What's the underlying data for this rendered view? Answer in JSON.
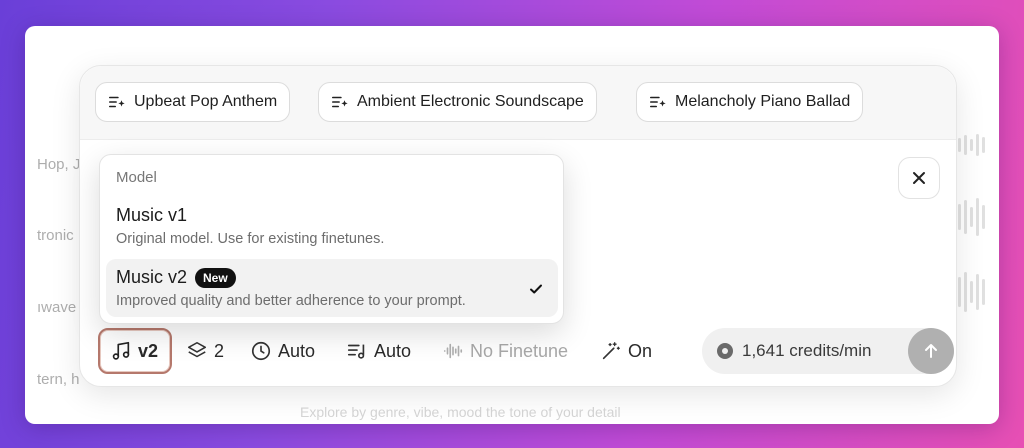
{
  "suggestions": [
    {
      "label": "Upbeat Pop Anthem",
      "icon": "sparkle-list-icon"
    },
    {
      "label": "Ambient Electronic Soundscape",
      "icon": "sparkle-list-icon"
    },
    {
      "label": "Melancholy Piano Ballad",
      "icon": "sparkle-list-icon"
    }
  ],
  "background_snippets": [
    "Hop, J",
    "tronic",
    "ıwave",
    "tern, h"
  ],
  "model_menu": {
    "header": "Model",
    "options": [
      {
        "title": "Music v1",
        "description": "Original model. Use for existing finetunes.",
        "badge": "",
        "selected": false
      },
      {
        "title": "Music v2",
        "description": "Improved quality and better adherence to your prompt.",
        "badge": "New",
        "selected": true
      }
    ]
  },
  "toolbar": {
    "model": {
      "label": "v2",
      "icon": "music-note-icon"
    },
    "layers": {
      "label": "2",
      "icon": "layers-icon"
    },
    "duration": {
      "label": "Auto",
      "icon": "clock-icon"
    },
    "lyrics": {
      "label": "Auto",
      "icon": "lyrics-icon"
    },
    "finetune": {
      "label": "No Finetune",
      "icon": "waveform-icon",
      "disabled": true
    },
    "enhance": {
      "label": "On",
      "icon": "magic-wand-icon"
    }
  },
  "credits": {
    "label": "1,641 credits/min",
    "icon": "coin-icon"
  },
  "bottom_text": "Explore by genre, vibe, mood the tone of your detail",
  "colors": {
    "accent_border": "#b5786c",
    "badge_bg": "#111111",
    "send_disabled": "#b0b0b0"
  }
}
